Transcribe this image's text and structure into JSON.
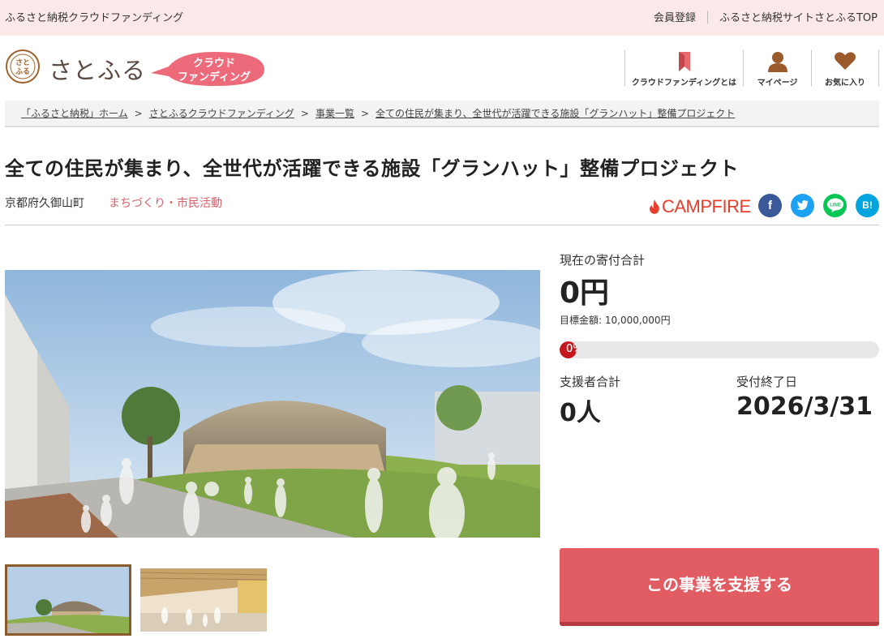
{
  "topbar": {
    "site_name": "ふるさと納税クラウドファンディング",
    "register": "会員登録",
    "top_link": "ふるさと納税サイトさとふるTOP"
  },
  "header": {
    "logo_text": "さとふる",
    "logo_mark_text": "さとふる",
    "badge_line1": "クラウド",
    "badge_line2": "ファンディング",
    "nav": [
      {
        "label": "クラウドファンディングとは",
        "icon": "bookmark-icon"
      },
      {
        "label": "マイページ",
        "icon": "user-icon"
      },
      {
        "label": "お気に入り",
        "icon": "heart-icon"
      }
    ]
  },
  "breadcrumb": [
    "「ふるさと納税」ホーム",
    "さとふるクラウドファンディング",
    "事業一覧",
    "全ての住民が集まり、全世代が活躍できる施設「グランハット」整備プロジェクト"
  ],
  "breadcrumb_sep": ">",
  "project": {
    "title": "全ての住民が集まり、全世代が活躍できる施設「グランハット」整備プロジェクト",
    "location": "京都府久御山町",
    "category": "まちづくり・市民活動",
    "partner": "CAMPFIRE"
  },
  "share": {
    "facebook": "f",
    "twitter": "",
    "line": "LINE",
    "hatena": "B!"
  },
  "stats": {
    "total_label": "現在の寄付合計",
    "total_value": "0円",
    "goal_label": "目標金額: 10,000,000円",
    "progress_text": "0%",
    "progress_percent": 0,
    "supporters_label": "支援者合計",
    "supporters_value": "0人",
    "end_label": "受付終了日",
    "end_value": "2026/3/31"
  },
  "cta": {
    "label": "この事業を支援する"
  },
  "colors": {
    "topbar_bg": "#fbe9ea",
    "accent": "#e25d63",
    "category": "#d9606a",
    "campfire": "#e83e2c",
    "progress_fill": "#c4161c",
    "nav_icon": "#9b5a2b"
  }
}
